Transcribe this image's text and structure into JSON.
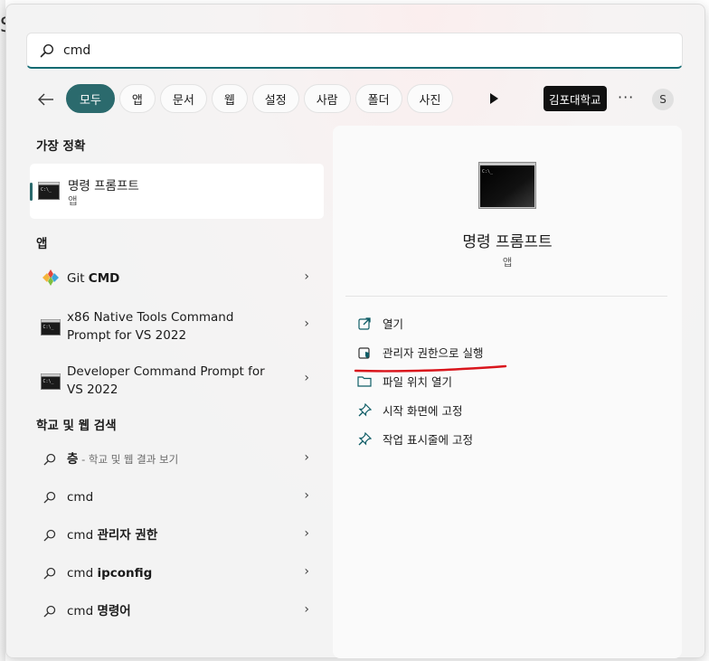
{
  "search": {
    "query": "cmd"
  },
  "filters": {
    "active": "모두",
    "chips": [
      "모두",
      "앱",
      "문서",
      "웹",
      "설정",
      "사람",
      "폴더",
      "사진"
    ],
    "org_label": "김포대학교",
    "avatar_initial": "S"
  },
  "left": {
    "best_match_heading": "가장 정확",
    "best_match": {
      "title": "명령 프롬프트",
      "subtitle": "앱"
    },
    "apps_heading": "앱",
    "apps": [
      {
        "label_plain": "Git ",
        "label_bold": "CMD"
      },
      {
        "line1": "x86 Native Tools Command",
        "line2": "Prompt for VS 2022"
      },
      {
        "line1": "Developer Command Prompt for",
        "line2": "VS 2022"
      }
    ],
    "web_heading": "학교 및 웹 검색",
    "web": [
      {
        "bold": "층",
        "plain": " - 학교 및 웹 결과 보기"
      },
      {
        "plain": "cmd",
        "bold": ""
      },
      {
        "plain": "cmd ",
        "bold": "관리자 권한"
      },
      {
        "plain": "cmd ",
        "bold": "ipconfig"
      },
      {
        "plain": "cmd ",
        "bold": "명령어"
      }
    ]
  },
  "detail": {
    "title": "명령 프롬프트",
    "subtitle": "앱",
    "actions": [
      {
        "label": "열기",
        "icon": "open-external-icon"
      },
      {
        "label": "관리자 권한으로 실행",
        "icon": "shield-icon"
      },
      {
        "label": "파일 위치 열기",
        "icon": "folder-icon"
      },
      {
        "label": "시작 화면에 고정",
        "icon": "pin-icon"
      },
      {
        "label": "작업 표시줄에 고정",
        "icon": "pin-icon"
      }
    ]
  },
  "colors": {
    "accent": "#2b6a6d",
    "annotation_red": "#d9151c"
  }
}
